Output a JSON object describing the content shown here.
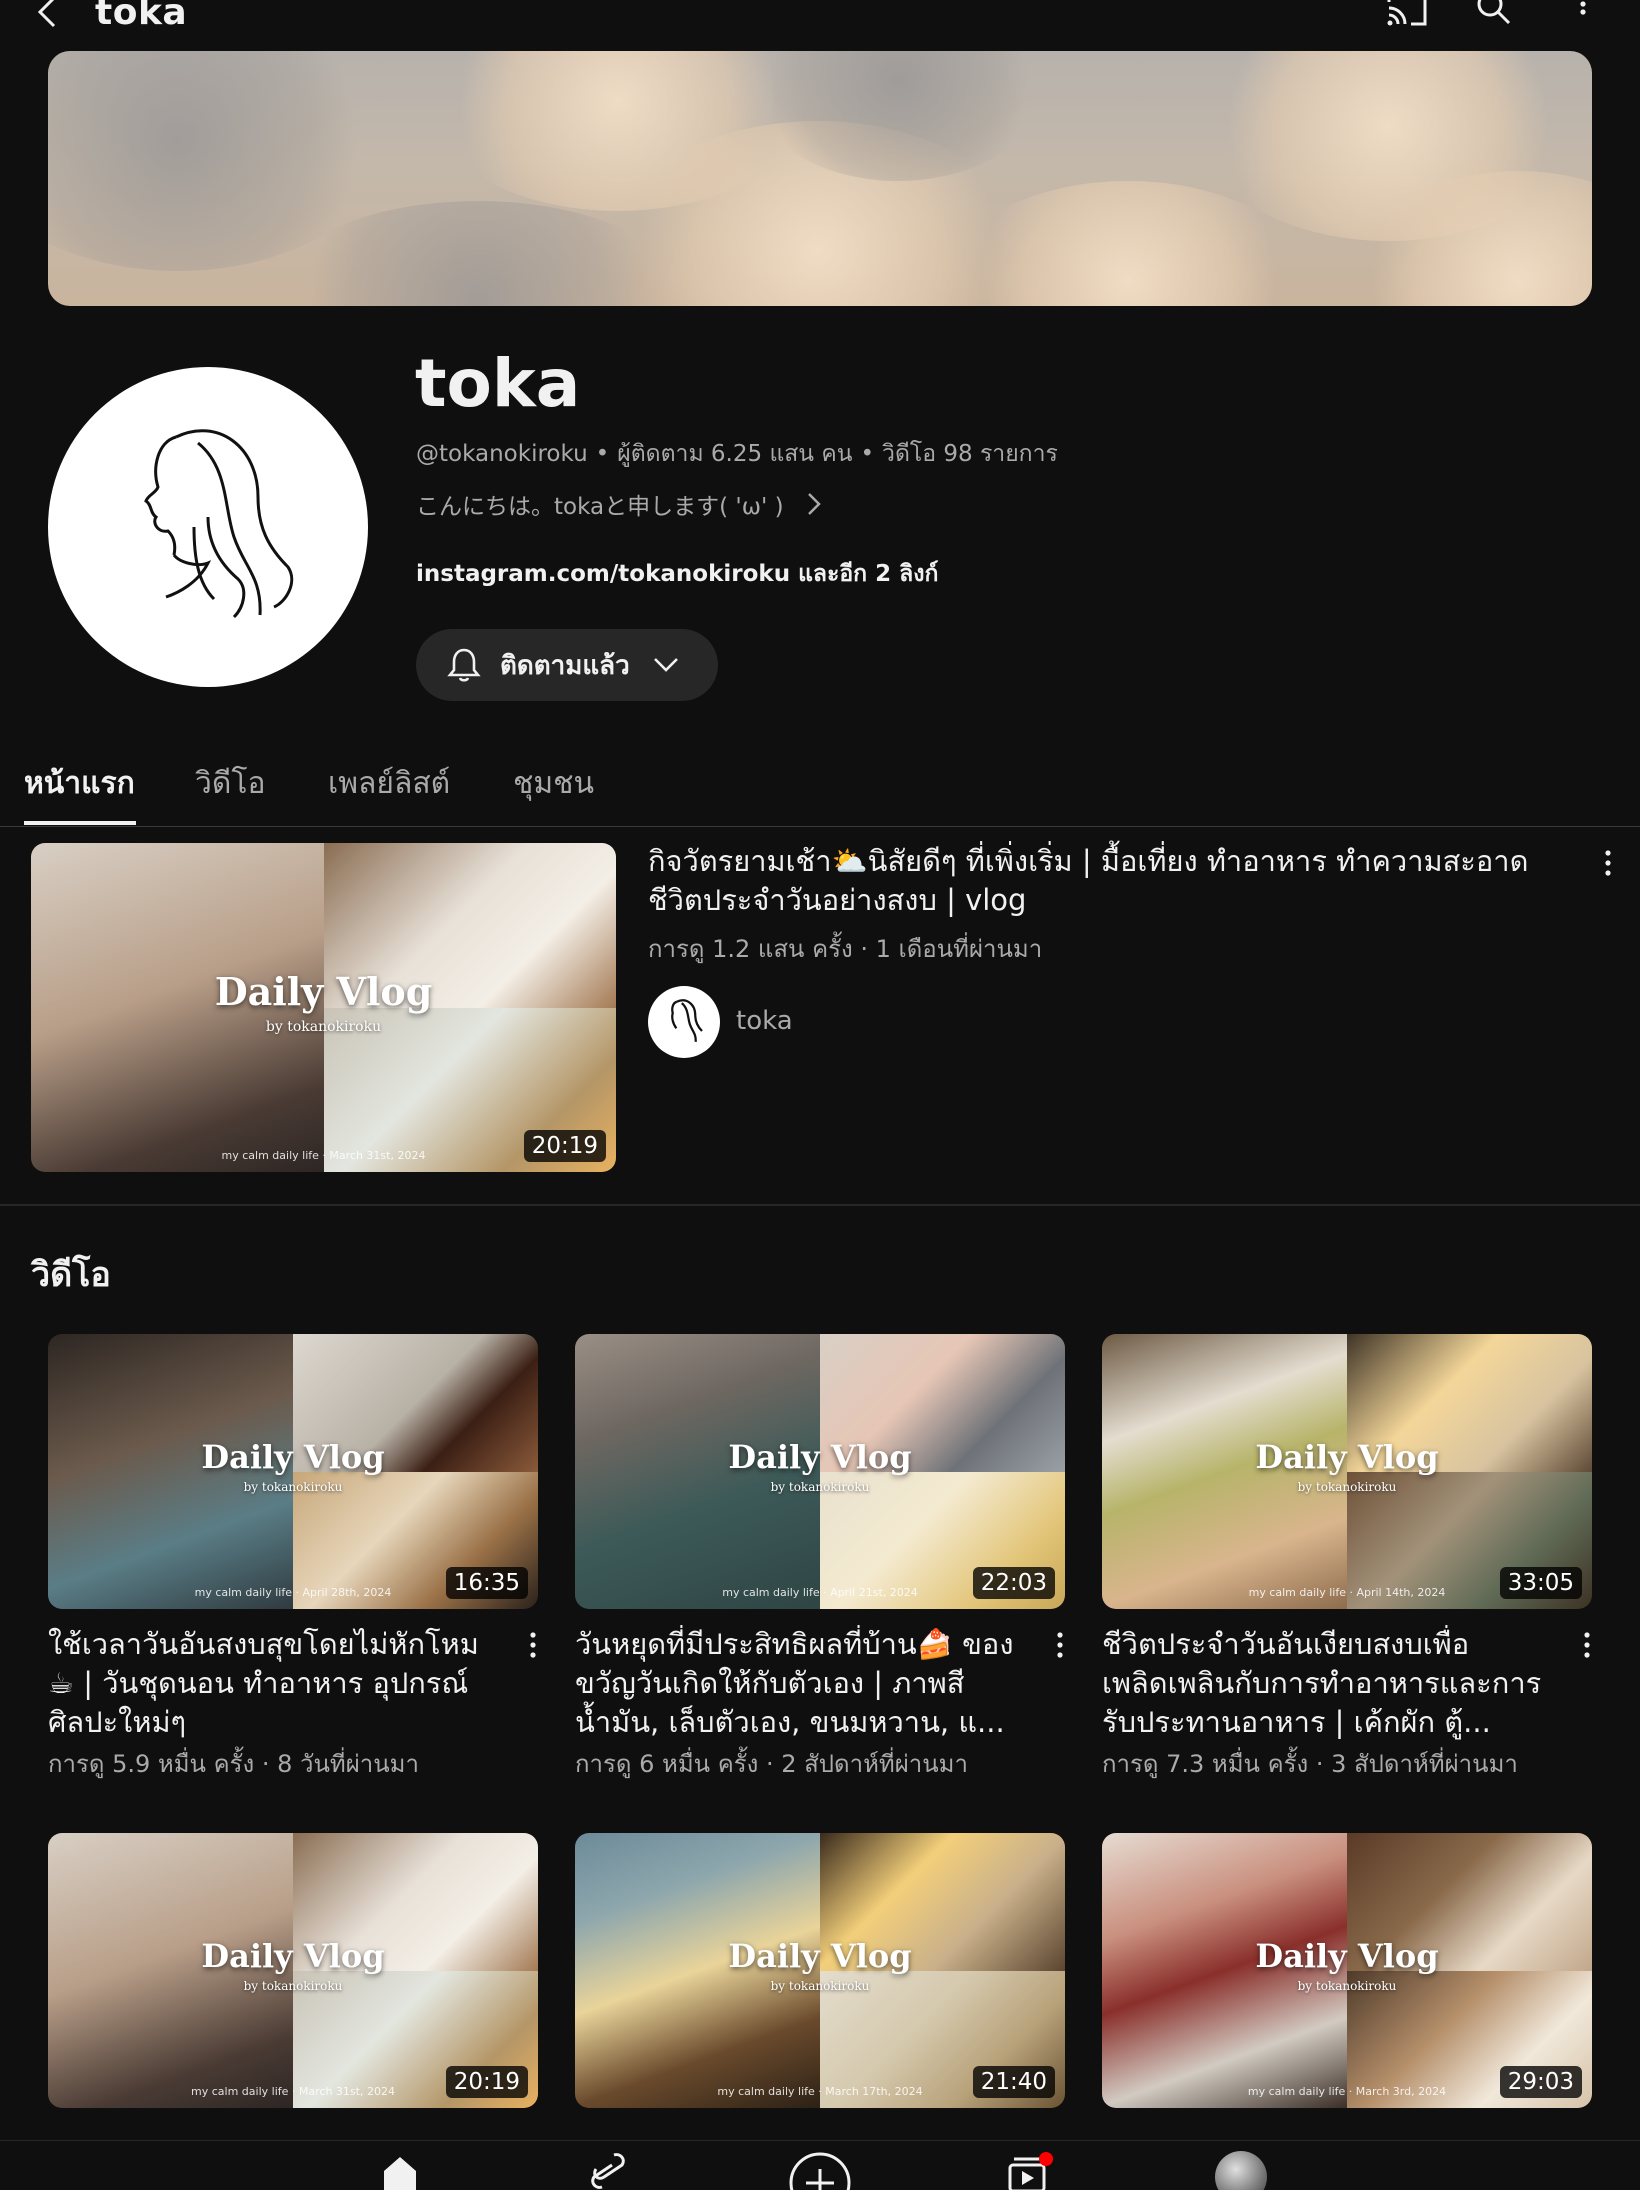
{
  "header": {
    "title": "toka",
    "icons": [
      "back-icon",
      "cast-icon",
      "search-icon",
      "more-icon"
    ]
  },
  "channel": {
    "name": "toka",
    "handle": "@tokanokiroku",
    "subscribers": "ผู้ติดตาม 6.25 แสน คน",
    "video_count": "วิดีโอ 98 รายการ",
    "separator": "•",
    "description": "こんにちは。tokaと申します( 'ω' )",
    "link": "instagram.com/tokanokiroku",
    "link_more": "และอีก 2 ลิงก์",
    "subscribe_label": "ติดตามแล้ว"
  },
  "tabs": [
    {
      "label": "หน้าแรก",
      "active": true
    },
    {
      "label": "วิดีโอ",
      "active": false
    },
    {
      "label": "เพลย์ลิสต์",
      "active": false
    },
    {
      "label": "ชุมชน",
      "active": false
    }
  ],
  "featured": {
    "title": "กิจวัตรยามเช้า⛅นิสัยดีๆ ที่เพิ่งเริ่ม | มื้อเที่ยง ทำอาหาร ทำความสะอาด ชีวิตประจำวันอย่างสงบ | vlog",
    "meta": "การดู 1.2 แสน ครั้ง · 1 เดือนที่ผ่านมา",
    "author": "toka",
    "duration": "20:19",
    "thumb_text": "Daily Vlog",
    "thumb_by": "by tokanokiroku",
    "thumb_foot": "my calm daily life · March 31st, 2024"
  },
  "videos_section": {
    "title": "วิดีโอ",
    "items": [
      {
        "title": "ใช้เวลาวันอันสงบสุขโดยไม่หักโหม ☕ | วันชุดนอน ทำอาหาร อุปกรณ์ศิลปะใหม่ๆ",
        "meta": "การดู 5.9 หมื่น ครั้ง · 8 วันที่ผ่านมา",
        "duration": "16:35",
        "thumb_text": "Daily Vlog",
        "thumb_by": "by tokanokiroku",
        "thumb_foot": "my calm daily life · April 28th, 2024"
      },
      {
        "title": "วันหยุดที่มีประสิทธิผลที่บ้าน🍰 ของขวัญวันเกิดให้กับตัวเอง | ภาพสีน้ำมัน, เล็บตัวเอง, ขนมหวาน, แ...",
        "meta": "การดู 6 หมื่น ครั้ง · 2 สัปดาห์ที่ผ่านมา",
        "duration": "22:03",
        "thumb_text": "Daily Vlog",
        "thumb_by": "by tokanokiroku",
        "thumb_foot": "my calm daily life · April 21st, 2024"
      },
      {
        "title": "ชีวิตประจำวันอันเงียบสงบเพื่อเพลิดเพลินกับการทำอาหารและการรับประทานอาหาร | เค้กผัก ตู้...",
        "meta": "การดู 7.3 หมื่น ครั้ง · 3 สัปดาห์ที่ผ่านมา",
        "duration": "33:05",
        "thumb_text": "Daily Vlog",
        "thumb_by": "by tokanokiroku",
        "thumb_foot": "my calm daily life · April 14th, 2024"
      },
      {
        "title": "",
        "meta": "",
        "duration": "20:19",
        "thumb_text": "Daily Vlog",
        "thumb_by": "by tokanokiroku",
        "thumb_foot": "my calm daily life · March 31st, 2024"
      },
      {
        "title": "",
        "meta": "",
        "duration": "21:40",
        "thumb_text": "Daily Vlog",
        "thumb_by": "by tokanokiroku",
        "thumb_foot": "my calm daily life · March 17th, 2024"
      },
      {
        "title": "",
        "meta": "",
        "duration": "29:03",
        "thumb_text": "Daily Vlog",
        "thumb_by": "by tokanokiroku",
        "thumb_foot": "my calm daily life · March 3rd, 2024"
      }
    ]
  },
  "bottom_nav": [
    "home-icon",
    "shorts-icon",
    "create-icon",
    "subscriptions-icon",
    "you-avatar"
  ],
  "colors": {
    "background": "#0f0f0f",
    "text": "#f1f1f1",
    "muted": "#aaaaaa",
    "chip": "#272727",
    "notification": "#ff0000"
  }
}
